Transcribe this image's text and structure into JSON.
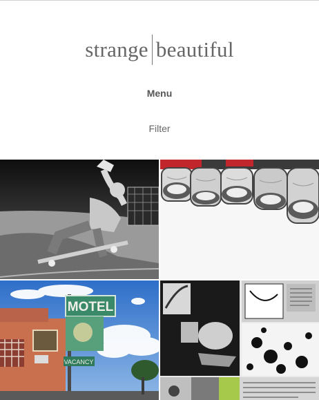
{
  "brand": {
    "left": "strange",
    "right": "beautiful"
  },
  "nav": {
    "menu_label": "Menu",
    "filter_label": "Filter"
  },
  "tiles": [
    {
      "name": "skateboarder-photo",
      "tone": "bw"
    },
    {
      "name": "glass-jars-photo",
      "tone": "bw-red"
    },
    {
      "name": "motel-sign-photo",
      "tone": "color"
    },
    {
      "name": "zine-collage-photo",
      "tone": "bw-collage"
    }
  ],
  "motel_sign": {
    "line1": "MOTEL",
    "line2": "VACANCY"
  },
  "colors": {
    "text": "#555555",
    "sky": "#3f7fd0",
    "sign_green": "#3a8a6a",
    "jar_red": "#c0262c"
  }
}
